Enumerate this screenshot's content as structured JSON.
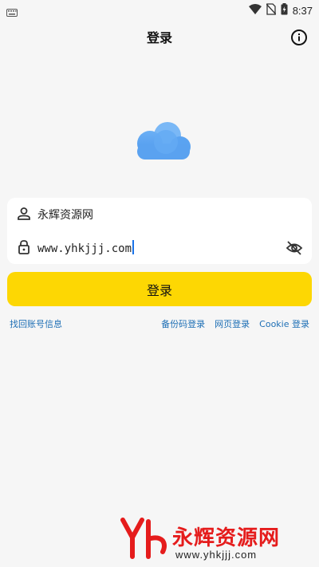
{
  "status_bar": {
    "time": "8:37"
  },
  "header": {
    "title": "登录"
  },
  "form": {
    "username_value": "永辉资源网",
    "password_value": "www.yhkjjj.com"
  },
  "login_button": {
    "label": "登录"
  },
  "links": {
    "recover": "找回账号信息",
    "backup_code_login": "备份码登录",
    "web_login": "网页登录",
    "cookie_login": "Cookie 登录"
  },
  "watermark": {
    "name": "永辉资源网",
    "url": "www.yhkjjj.com"
  },
  "colors": {
    "accent": "#fdd703",
    "link": "#1e6fb5",
    "cloud": "#4f9ef0",
    "brand": "#e51c1c"
  }
}
